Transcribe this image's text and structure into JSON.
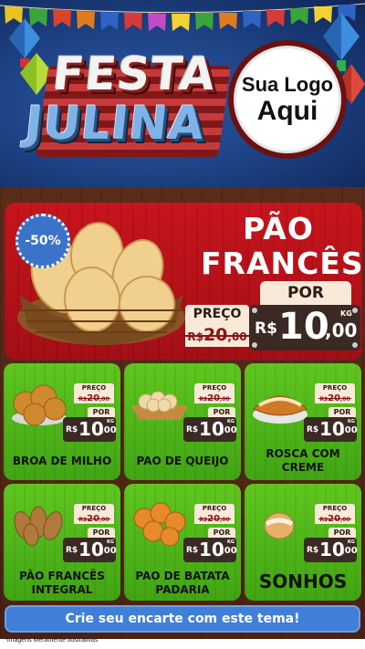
{
  "header": {
    "title_line1": "FESTA",
    "title_line2": "JULINA",
    "logo_line1": "Sua Logo",
    "logo_line2": "Aqui"
  },
  "hero": {
    "discount": "-50%",
    "name_line1": "PÃO",
    "name_line2": "FRANCÊS",
    "preco_label": "PREÇO",
    "por_label": "POR",
    "old_currency": "R$",
    "old_int": "20",
    "old_dec": ",00",
    "new_currency": "R$",
    "new_int": "10",
    "new_dec": ",00",
    "unit": "KG"
  },
  "products": [
    {
      "name": "BROA DE MILHO",
      "preco_label": "PREÇO",
      "por_label": "POR",
      "old_currency": "R$",
      "old_int": "20",
      "old_dec": ",00",
      "new_currency": "R$",
      "new_int": "10",
      "new_dec": ",00",
      "unit": "KG"
    },
    {
      "name": "PAO DE QUEIJO",
      "preco_label": "PREÇO",
      "por_label": "POR",
      "old_currency": "R$",
      "old_int": "20",
      "old_dec": ",00",
      "new_currency": "R$",
      "new_int": "10",
      "new_dec": ",00",
      "unit": "KG"
    },
    {
      "name": "ROSCA COM CREME",
      "preco_label": "PREÇO",
      "por_label": "POR",
      "old_currency": "R$",
      "old_int": "20",
      "old_dec": ",00",
      "new_currency": "R$",
      "new_int": "10",
      "new_dec": ",00",
      "unit": "KG"
    },
    {
      "name": "PÃO FRANCÊS INTEGRAL",
      "preco_label": "PREÇO",
      "por_label": "POR",
      "old_currency": "R$",
      "old_int": "20",
      "old_dec": ",00",
      "new_currency": "R$",
      "new_int": "10",
      "new_dec": ",00",
      "unit": "KG"
    },
    {
      "name": "PAO DE BATATA PADARIA",
      "preco_label": "PREÇO",
      "por_label": "POR",
      "old_currency": "R$",
      "old_int": "20",
      "old_dec": ",00",
      "new_currency": "R$",
      "new_int": "10",
      "new_dec": ",00",
      "unit": "KG"
    },
    {
      "name": "SONHOS",
      "preco_label": "PREÇO",
      "por_label": "POR",
      "old_currency": "R$",
      "old_int": "20",
      "old_dec": ",00",
      "new_currency": "R$",
      "new_int": "10",
      "new_dec": ",00",
      "unit": "KG"
    }
  ],
  "cta_label": "Crie seu encarte com este tema!",
  "disclaimer": "*Imagens Meramente Ilustrativas",
  "colors": {
    "header_blue": "#1c3f80",
    "hero_red": "#b5121a",
    "card_green": "#4fb81a",
    "wood_brown": "#4e2516",
    "price_dark": "#3b2a24",
    "cta_blue": "#3f7fd8"
  }
}
